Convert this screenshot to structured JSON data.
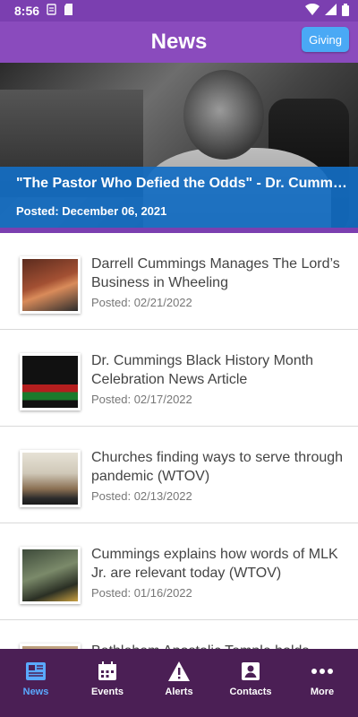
{
  "statusbar": {
    "time": "8:56"
  },
  "appbar": {
    "title": "News",
    "giving_label": "Giving"
  },
  "hero": {
    "title": "\"The Pastor Who Defied the Odds\" - Dr. Cummings",
    "date": "Posted: December 06, 2021"
  },
  "news": [
    {
      "title": "Darrell Cummings Manages The Lord’s Business in Wheeling",
      "date": "Posted: 02/21/2022"
    },
    {
      "title": "Dr. Cummings Black History Month Celebration News Article",
      "date": "Posted: 02/17/2022"
    },
    {
      "title": "Churches finding ways to serve through pandemic (WTOV)",
      "date": "Posted: 02/13/2022"
    },
    {
      "title": "Cummings explains how words of MLK Jr. are relevant today (WTOV)",
      "date": "Posted: 01/16/2022"
    },
    {
      "title": "Bethlehem Apostolic Temple holds",
      "date": ""
    }
  ],
  "tabs": [
    {
      "label": "News",
      "icon": "news-icon",
      "active": true
    },
    {
      "label": "Events",
      "icon": "calendar-icon"
    },
    {
      "label": "Alerts",
      "icon": "alert-icon"
    },
    {
      "label": "Contacts",
      "icon": "contact-card-icon"
    },
    {
      "label": "More",
      "icon": "more-dots-icon"
    }
  ],
  "colors": {
    "primary": "#8a4bbd",
    "accent": "#4aa9f5",
    "tabbar": "#4b1f55",
    "tab_active": "#5aa9ff",
    "hero_caption": "#146ec3"
  }
}
